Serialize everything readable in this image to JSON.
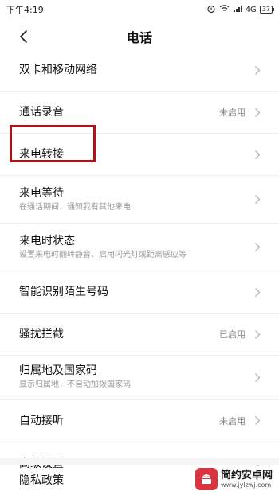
{
  "status_bar": {
    "time": "下午4:19",
    "network": "4G",
    "battery": "37",
    "icons": [
      "alarm-icon",
      "wifi-icon",
      "signal-icon",
      "battery-icon"
    ]
  },
  "header": {
    "title": "电话",
    "back_icon": "chevron-left-icon"
  },
  "settings": {
    "items": [
      {
        "label": "双卡和移动网络"
      },
      {
        "label": "通话录音",
        "value": "未启用"
      },
      {
        "label": "来电转接"
      },
      {
        "label": "来电等待",
        "subtitle": "在通话期间，通知我有其他来电"
      },
      {
        "label": "来电时状态",
        "subtitle": "设置来电时翻转静音、启用闪光灯或距离感应等"
      },
      {
        "label": "智能识别陌生号码"
      },
      {
        "label": "骚扰拦截",
        "value": "已启用"
      },
      {
        "label": "归属地及国家码",
        "subtitle": "显示归属地，不自动加拨国家码"
      },
      {
        "label": "自动接听",
        "value": "未启用"
      },
      {
        "label": "高级设置"
      }
    ],
    "privacy": "隐私政策"
  },
  "highlight": {
    "color": "#b0111b"
  },
  "watermark": {
    "title": "简约安卓网",
    "url": "www.jylzwj.com"
  }
}
